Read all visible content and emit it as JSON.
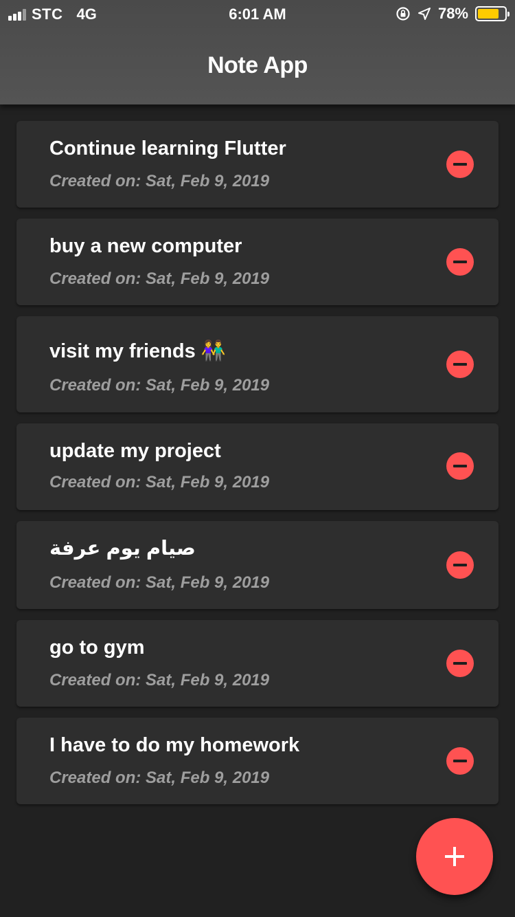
{
  "status_bar": {
    "carrier": "STC",
    "network": "4G",
    "time": "6:01 AM",
    "battery": "78%",
    "battery_level": 0.78,
    "battery_color": "#ffcc00",
    "icons": [
      "signal-icon",
      "orientation-lock-icon",
      "location-icon",
      "battery-icon"
    ]
  },
  "app_bar": {
    "title": "Note App"
  },
  "notes": [
    {
      "title": " Continue learning Flutter",
      "date": "Created on: Sat, Feb 9, 2019"
    },
    {
      "title": "buy a new computer",
      "date": "Created on: Sat, Feb 9, 2019"
    },
    {
      "title": "visit my friends 👫",
      "date": "Created on: Sat, Feb 9, 2019"
    },
    {
      "title": "update my project",
      "date": "Created on: Sat, Feb 9, 2019"
    },
    {
      "title": "صيام يوم عرفة",
      "date": "Created on: Sat, Feb 9, 2019"
    },
    {
      "title": "go to gym",
      "date": "Created on: Sat, Feb 9, 2019"
    },
    {
      "title": "I have to do my homework",
      "date": "Created on: Sat, Feb 9, 2019"
    }
  ],
  "actions": {
    "delete_icon": "remove-circle-icon",
    "fab_icon": "plus-icon"
  },
  "colors": {
    "background": "#212121",
    "card": "#2e2e2e",
    "accent": "#ff5252",
    "date_text": "#9e9e9e"
  }
}
